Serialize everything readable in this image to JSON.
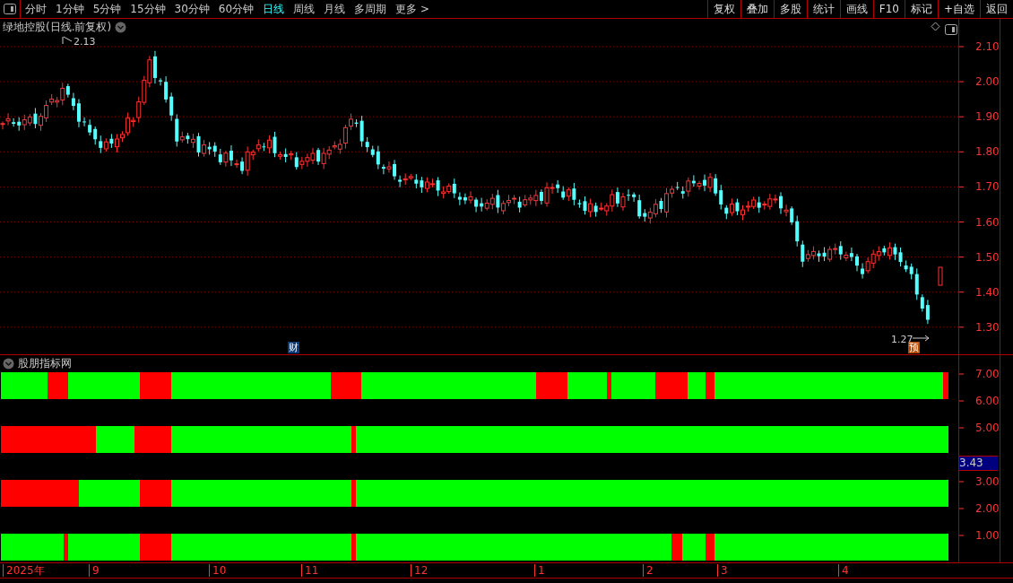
{
  "toolbar": {
    "periods": [
      {
        "label": "分时",
        "selected": false
      },
      {
        "label": "1分钟",
        "selected": false
      },
      {
        "label": "5分钟",
        "selected": false
      },
      {
        "label": "15分钟",
        "selected": false
      },
      {
        "label": "30分钟",
        "selected": false
      },
      {
        "label": "60分钟",
        "selected": false
      },
      {
        "label": "日线",
        "selected": true
      },
      {
        "label": "周线",
        "selected": false
      },
      {
        "label": "月线",
        "selected": false
      },
      {
        "label": "多周期",
        "selected": false
      },
      {
        "label": "更多 >",
        "selected": false
      }
    ],
    "actions": [
      "复权",
      "叠加",
      "多股",
      "统计",
      "画线",
      "F10",
      "标记",
      "+自选",
      "返回"
    ]
  },
  "price_chart": {
    "title": "绿地控股(日线.前复权)",
    "high_label": "2.13",
    "low_label": "1.27",
    "markers": [
      {
        "kind": "finance",
        "label": "财"
      },
      {
        "kind": "forecast",
        "label": "预"
      }
    ],
    "price_axis": [
      "2.10",
      "2.00",
      "1.90",
      "1.80",
      "1.70",
      "1.60",
      "1.50",
      "1.40",
      "1.30"
    ]
  },
  "indicator": {
    "title": "股朋指标网",
    "rows": [
      {
        "segments": [
          {
            "color": "#00ff00"
          },
          {
            "color": "#ff0000"
          },
          {
            "color": "#00ff00"
          },
          {
            "color": "#ff0000"
          },
          {
            "color": "#00ff00"
          },
          {
            "color": "#ff0000"
          },
          {
            "color": "#00ff00"
          },
          {
            "color": "#ff0000"
          },
          {
            "color": "#00ff00"
          },
          {
            "color": "#ff0000"
          },
          {
            "color": "#00ff00"
          },
          {
            "color": "#ff0000"
          },
          {
            "color": "#00ff00"
          },
          {
            "color": "#ff0000"
          },
          {
            "color": "#00ff00"
          },
          {
            "color": "#ff0000"
          }
        ]
      },
      {
        "segments": [
          {
            "color": "#ff0000"
          },
          {
            "color": "#00ff00"
          },
          {
            "color": "#ff0000"
          },
          {
            "color": "#00ff00"
          },
          {
            "color": "#ff0000"
          },
          {
            "color": "#00ff00"
          }
        ]
      },
      {
        "segments": [
          {
            "color": "#ff0000"
          },
          {
            "color": "#00ff00"
          },
          {
            "color": "#ff0000"
          },
          {
            "color": "#00ff00"
          },
          {
            "color": "#ff0000"
          },
          {
            "color": "#00ff00"
          }
        ]
      },
      {
        "segments": [
          {
            "color": "#00ff00"
          },
          {
            "color": "#ff0000"
          },
          {
            "color": "#00ff00"
          },
          {
            "color": "#ff0000"
          },
          {
            "color": "#00ff00"
          },
          {
            "color": "#ff0000"
          },
          {
            "color": "#00ff00"
          },
          {
            "color": "#ff0000"
          },
          {
            "color": "#00ff00"
          },
          {
            "color": "#ff0000"
          },
          {
            "color": "#00ff00"
          }
        ]
      }
    ],
    "axis": [
      "7.00",
      "6.00",
      "5.00",
      "3.00",
      "2.00",
      "1.00"
    ],
    "current_value": "3.43"
  },
  "date_axis": [
    "2025年",
    "9",
    "10",
    "11",
    "12",
    "1",
    "2",
    "3",
    "4"
  ]
}
